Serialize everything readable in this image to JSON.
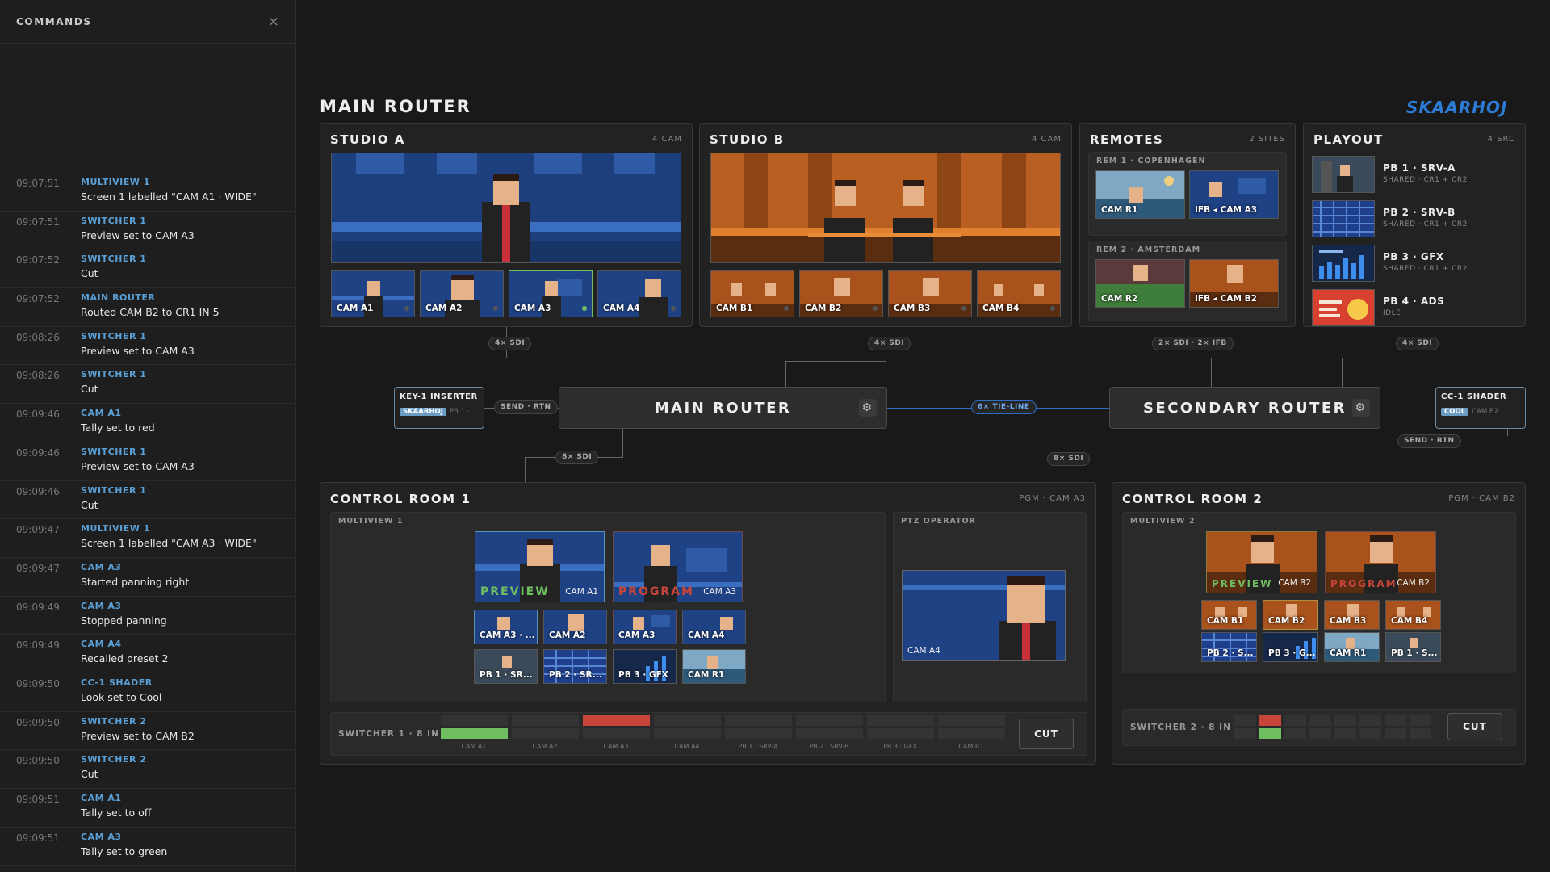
{
  "sidebar": {
    "title": "COMMANDS",
    "close_glyph": "×",
    "commands": [
      {
        "time": "09:07:51",
        "source": "MULTIVIEW 1",
        "detail": "Screen 1 labelled \"CAM A1 · WIDE\""
      },
      {
        "time": "09:07:51",
        "source": "SWITCHER 1",
        "detail": "Preview set to CAM A3"
      },
      {
        "time": "09:07:52",
        "source": "SWITCHER 1",
        "detail": "Cut"
      },
      {
        "time": "09:07:52",
        "source": "MAIN ROUTER",
        "detail": "Routed CAM B2 to CR1 IN 5"
      },
      {
        "time": "09:08:26",
        "source": "SWITCHER 1",
        "detail": "Preview set to CAM A3"
      },
      {
        "time": "09:08:26",
        "source": "SWITCHER 1",
        "detail": "Cut"
      },
      {
        "time": "09:09:46",
        "source": "CAM A1",
        "detail": "Tally set to red"
      },
      {
        "time": "09:09:46",
        "source": "SWITCHER 1",
        "detail": "Preview set to CAM A3"
      },
      {
        "time": "09:09:46",
        "source": "SWITCHER 1",
        "detail": "Cut"
      },
      {
        "time": "09:09:47",
        "source": "MULTIVIEW 1",
        "detail": "Screen 1 labelled \"CAM A3 · WIDE\""
      },
      {
        "time": "09:09:47",
        "source": "CAM A3",
        "detail": "Started panning right"
      },
      {
        "time": "09:09:49",
        "source": "CAM A3",
        "detail": "Stopped panning"
      },
      {
        "time": "09:09:49",
        "source": "CAM A4",
        "detail": "Recalled preset 2"
      },
      {
        "time": "09:09:50",
        "source": "CC-1 SHADER",
        "detail": "Look set to Cool"
      },
      {
        "time": "09:09:50",
        "source": "SWITCHER 2",
        "detail": "Preview set to CAM B2"
      },
      {
        "time": "09:09:50",
        "source": "SWITCHER 2",
        "detail": "Cut"
      },
      {
        "time": "09:09:51",
        "source": "CAM A1",
        "detail": "Tally set to off"
      },
      {
        "time": "09:09:51",
        "source": "CAM A3",
        "detail": "Tally set to green"
      }
    ]
  },
  "header": {
    "title": "MAIN ROUTER",
    "logo": "SKAARHOJ"
  },
  "studio_a": {
    "title": "STUDIO A",
    "count": "4 CAM",
    "cams": [
      "CAM A1",
      "CAM A2",
      "CAM A3",
      "CAM A4"
    ]
  },
  "studio_b": {
    "title": "STUDIO B",
    "count": "4 CAM",
    "cams": [
      "CAM B1",
      "CAM B2",
      "CAM B3",
      "CAM B4"
    ]
  },
  "remotes": {
    "title": "REMOTES",
    "count": "2 SITES",
    "rem1": {
      "label": "REM 1 · COPENHAGEN",
      "a": "CAM R1",
      "b": "IFB ◂ CAM A3"
    },
    "rem2": {
      "label": "REM 2 · AMSTERDAM",
      "a": "CAM R2",
      "b": "IFB ◂ CAM B2"
    }
  },
  "playout": {
    "title": "PLAYOUT",
    "count": "4 SRC",
    "items": [
      {
        "name": "PB 1 · SRV-A",
        "sub": "SHARED · CR1 + CR2"
      },
      {
        "name": "PB 2 · SRV-B",
        "sub": "SHARED · CR1 + CR2"
      },
      {
        "name": "PB 3 · GFX",
        "sub": "SHARED · CR1 + CR2"
      },
      {
        "name": "PB 4 · ADS",
        "sub": "IDLE"
      }
    ]
  },
  "links": {
    "a": "4× SDI",
    "b": "4× SDI",
    "rem": "2× SDI · 2× IFB",
    "pb": "4× SDI",
    "send_rtn_left": "SEND · RTN",
    "tie": "6× TIE-LINE",
    "send_rtn_right": "SEND · RTN",
    "cr1": "8× SDI",
    "cr2": "8× SDI"
  },
  "routers": {
    "main": "MAIN ROUTER",
    "secondary": "SECONDARY ROUTER",
    "gear": "⚙"
  },
  "key_inserter": {
    "title": "KEY-1 INSERTER",
    "badge": "SKAARHOJ",
    "sub": "PB 1 · ..."
  },
  "shader": {
    "title": "CC-1 SHADER",
    "badge": "COOL",
    "sub": "CAM B2"
  },
  "cr1": {
    "title": "CONTROL ROOM 1",
    "pgm": "PGM · CAM A3",
    "mv_label": "MULTIVIEW 1",
    "preview": {
      "word": "PREVIEW",
      "cam": "CAM A1"
    },
    "program": {
      "word": "PROGRAM",
      "cam": "CAM A3"
    },
    "mv_tiles": [
      "CAM A3 · ...",
      "CAM A2",
      "CAM A3",
      "CAM A4",
      "PB 1 · SR...",
      "PB 2 · SR...",
      "PB 3 · GFX",
      "CAM R1"
    ],
    "ptz_label": "PTZ OPERATOR",
    "ptz_cam": "CAM A4",
    "switcher_label": "SWITCHER 1 · 8 IN",
    "inputs": [
      "CAM A1",
      "CAM A2",
      "CAM A3",
      "CAM A4",
      "PB 1 · SRV-A",
      "PB 2 · SRV-B",
      "PB 3 · GFX",
      "CAM R1"
    ],
    "program_index": 3,
    "preview_index": 1,
    "cut": "CUT"
  },
  "cr2": {
    "title": "CONTROL ROOM 2",
    "pgm": "PGM · CAM B2",
    "mv_label": "MULTIVIEW 2",
    "preview": {
      "word": "PREVIEW",
      "cam": "CAM B2"
    },
    "program": {
      "word": "PROGRAM",
      "cam": "CAM B2"
    },
    "mv_tiles": [
      "CAM B1",
      "CAM B2",
      "CAM B3",
      "CAM B4",
      "PB 2 · S...",
      "PB 3 · G...",
      "CAM R1",
      "PB 1 · S..."
    ],
    "switcher_label": "SWITCHER 2 · 8 IN",
    "program_index": 2,
    "preview_index": 2,
    "cut": "CUT"
  },
  "colors": {
    "accent": "#5aa0d6",
    "program": "#c8453a",
    "preview": "#6fbf62",
    "tie": "#2c6fc4"
  }
}
